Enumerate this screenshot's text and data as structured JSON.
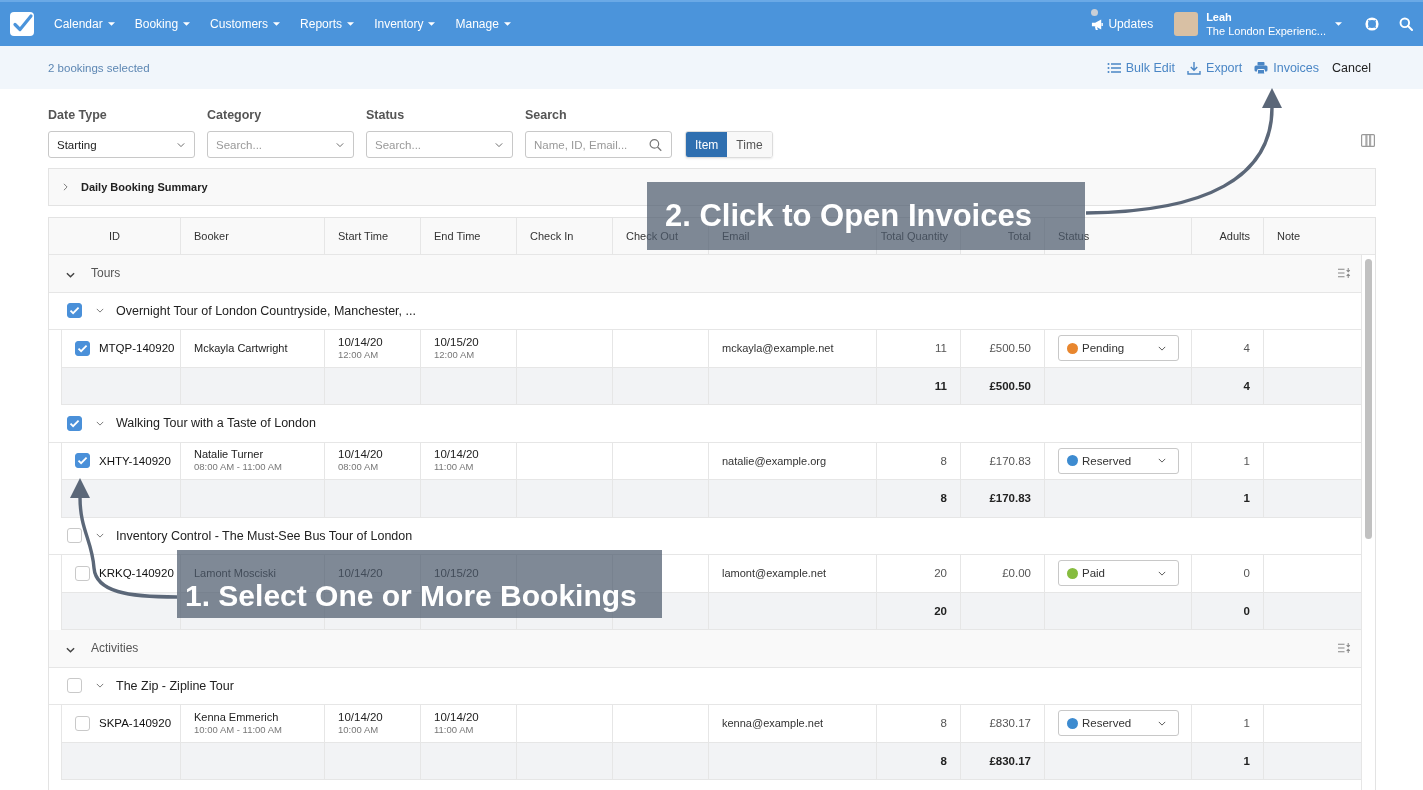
{
  "nav": {
    "items": [
      {
        "label": "Calendar"
      },
      {
        "label": "Booking"
      },
      {
        "label": "Customers"
      },
      {
        "label": "Reports"
      },
      {
        "label": "Inventory"
      },
      {
        "label": "Manage"
      }
    ],
    "updates": {
      "label": "Updates",
      "unread": true
    },
    "user": {
      "name": "Leah",
      "company": "The London Experienc..."
    }
  },
  "selection_bar": {
    "summary": "2 bookings selected",
    "actions": [
      {
        "label": "Bulk Edit",
        "kind": "list"
      },
      {
        "label": "Export",
        "kind": "download"
      },
      {
        "label": "Invoices",
        "kind": "print"
      },
      {
        "label": "Cancel",
        "kind": "plain"
      }
    ]
  },
  "filters": [
    {
      "label": "Date Type",
      "kind": "select",
      "value": "Starting"
    },
    {
      "label": "Category",
      "kind": "select",
      "placeholder": "Search..."
    },
    {
      "label": "Status",
      "kind": "select",
      "placeholder": "Search..."
    },
    {
      "label": "Search",
      "kind": "search",
      "placeholder": "Name, ID, Email..."
    }
  ],
  "view_toggle": [
    {
      "label": "Item",
      "selected": true
    },
    {
      "label": "Time",
      "selected": false
    }
  ],
  "summary_panel": {
    "title": "Daily Booking Summary",
    "expanded": false
  },
  "table": {
    "columns": [
      "ID",
      "Booker",
      "Start Time",
      "End Time",
      "Check In",
      "Check Out",
      "Email",
      "Total Quantity",
      "Total",
      "Status",
      "Adults",
      "Note"
    ],
    "groups": [
      {
        "name": "Tours",
        "expanded": true,
        "items": [
          {
            "name": "Overnight Tour of London Countryside, Manchester, ...",
            "checked": true,
            "expanded": true,
            "bookings": [
              {
                "id": "MTQP-140920",
                "checked": true,
                "booker": "Mckayla Cartwright",
                "start_date": "10/14/20",
                "start_time": "12:00 AM",
                "end_date": "10/15/20",
                "end_time": "12:00 AM",
                "email": "mckayla@example.net",
                "quantity": "11",
                "total": "£500.50",
                "status": {
                  "label": "Pending",
                  "color": "#e8862e"
                },
                "adults": "4"
              }
            ],
            "totals": {
              "quantity": "11",
              "total": "£500.50",
              "adults": "4"
            }
          },
          {
            "name": "Walking Tour with a Taste of London",
            "checked": true,
            "expanded": true,
            "bookings": [
              {
                "id": "XHTY-140920",
                "checked": true,
                "booker": "Natalie Turner",
                "time_range": "08:00 AM - 11:00 AM",
                "start_date": "10/14/20",
                "start_time": "08:00 AM",
                "end_date": "10/14/20",
                "end_time": "11:00 AM",
                "email": "natalie@example.org",
                "quantity": "8",
                "total": "£170.83",
                "status": {
                  "label": "Reserved",
                  "color": "#3d8bd0"
                },
                "adults": "1"
              }
            ],
            "totals": {
              "quantity": "8",
              "total": "£170.83",
              "adults": "1"
            }
          },
          {
            "name": "Inventory Control - The Must-See Bus Tour of London",
            "checked": false,
            "expanded": true,
            "bookings": [
              {
                "id": "KRKQ-140920",
                "checked": false,
                "booker": "Lamont Mosciski",
                "start_date": "10/14/20",
                "end_date": "10/15/20",
                "email": "lamont@example.net",
                "quantity": "20",
                "total": "£0.00",
                "status": {
                  "label": "Paid",
                  "color": "#86bc3f"
                },
                "adults": "0"
              }
            ],
            "totals": {
              "quantity": "20",
              "adults": "0"
            }
          }
        ]
      },
      {
        "name": "Activities",
        "expanded": true,
        "items": [
          {
            "name": "The Zip - Zipline Tour",
            "checked": false,
            "expanded": true,
            "bookings": [
              {
                "id": "SKPA-140920",
                "checked": false,
                "booker": "Kenna Emmerich",
                "time_range": "10:00 AM - 11:00 AM",
                "start_date": "10/14/20",
                "start_time": "10:00 AM",
                "end_date": "10/14/20",
                "end_time": "11:00 AM",
                "email": "kenna@example.net",
                "quantity": "8",
                "total": "£830.17",
                "status": {
                  "label": "Reserved",
                  "color": "#3d8bd0"
                },
                "adults": "1"
              }
            ],
            "totals": {
              "quantity": "8",
              "total": "£830.17",
              "adults": "1"
            }
          }
        ]
      }
    ]
  },
  "callouts": [
    {
      "text": "2. Click to Open Invoices"
    },
    {
      "text": "1. Select One or More Bookings"
    }
  ]
}
